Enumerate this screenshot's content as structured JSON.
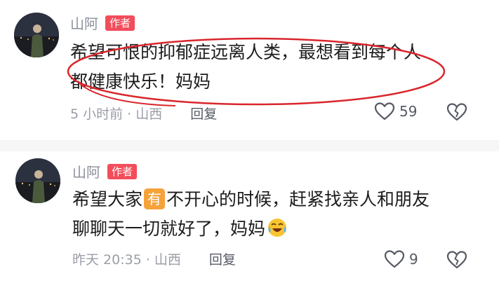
{
  "comments": [
    {
      "author": "山阿",
      "badge": "作者",
      "text_line1": "希望可恨的抑郁症远离人类，最想看到每个人",
      "text_line2": "都健康快乐！妈妈",
      "meta": "5 小时前 · 山西",
      "reply_label": "回复",
      "likes": "59"
    },
    {
      "author": "山阿",
      "badge": "作者",
      "text_line1_before": "希望大家",
      "emoji_box": "有",
      "text_line1_after": "不开心的时候，赶紧找亲人和朋友",
      "text_line2": "聊聊天一切就好了，妈妈",
      "meta": "昨天 20:35 · 山西",
      "reply_label": "回复",
      "likes": "9"
    }
  ],
  "annotation": {
    "type": "red-ellipse-highlight",
    "color": "#d9262c"
  },
  "colors": {
    "badge": "#f24d5b",
    "meta": "#9a9ea6",
    "divider": "#f6f6f6"
  },
  "icons": [
    "avatar",
    "heart-outline-icon",
    "broken-heart-icon",
    "laughing-crying-emoji-icon"
  ]
}
